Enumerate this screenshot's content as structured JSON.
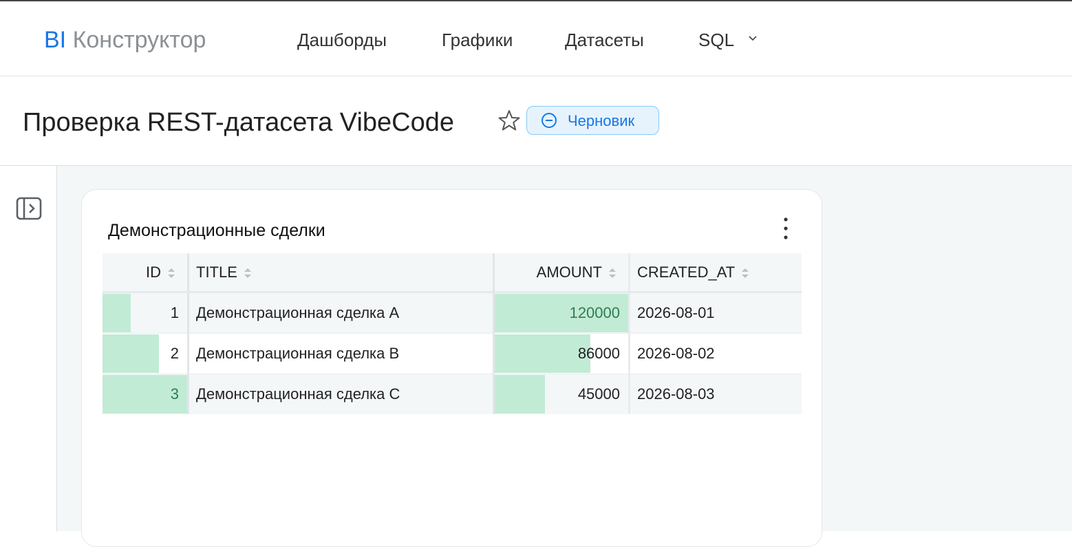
{
  "navbar": {
    "brand_prefix": "BI",
    "brand_name": "Конструктор",
    "items": [
      {
        "label": "Дашборды"
      },
      {
        "label": "Графики"
      },
      {
        "label": "Датасеты"
      },
      {
        "label": "SQL"
      }
    ]
  },
  "header": {
    "title": "Проверка REST-датасета VibeCode",
    "status_badge": "Черновик"
  },
  "colors": {
    "accent": "#1677e6",
    "badge_bg": "#e6f3fd",
    "bar_fill": "#c2ebd6",
    "content_bg": "#f4f7f8"
  },
  "icons": [
    "star-icon",
    "minus-circle-icon",
    "sidebar-toggle-icon",
    "more-vertical-icon",
    "chevron-down-icon",
    "sort-icon"
  ],
  "card": {
    "title": "Демонстрационные сделки",
    "table": {
      "columns": [
        "ID",
        "TITLE",
        "AMOUNT",
        "CREATED_AT"
      ],
      "rows": [
        {
          "id": "1",
          "title": "Демонстрационная сделка A",
          "amount": "120000",
          "created_at": "2026-08-01",
          "id_fill": 0.333,
          "amount_fill": 1.0
        },
        {
          "id": "2",
          "title": "Демонстрационная сделка B",
          "amount": "86000",
          "created_at": "2026-08-02",
          "id_fill": 0.667,
          "amount_fill": 0.717
        },
        {
          "id": "3",
          "title": "Демонстрационная сделка C",
          "amount": "45000",
          "created_at": "2026-08-03",
          "id_fill": 1.0,
          "amount_fill": 0.375
        }
      ]
    }
  }
}
